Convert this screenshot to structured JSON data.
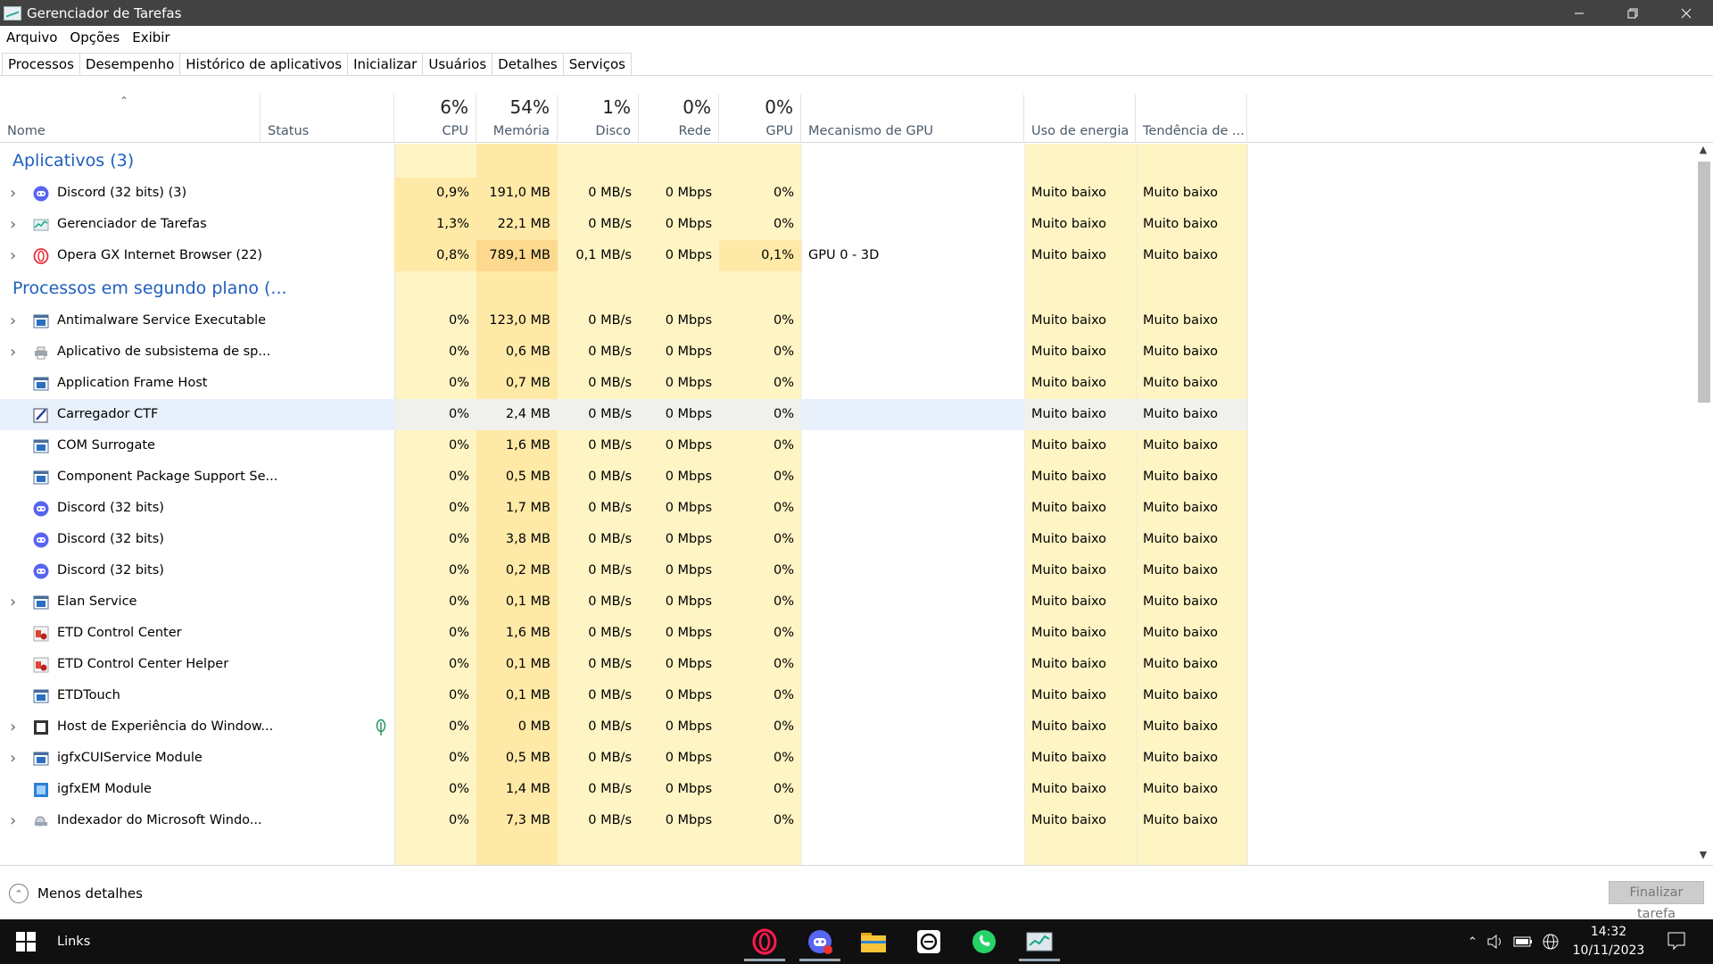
{
  "window": {
    "title": "Gerenciador de Tarefas",
    "minimize_icon": "minimize-icon",
    "restore_icon": "restore-icon",
    "close_icon": "close-icon"
  },
  "menu": [
    "Arquivo",
    "Opções",
    "Exibir"
  ],
  "tabs": [
    "Processos",
    "Desempenho",
    "Histórico de aplicativos",
    "Inicializar",
    "Usuários",
    "Detalhes",
    "Serviços"
  ],
  "columns": {
    "name": "Nome",
    "status": "Status",
    "cpu": {
      "pct": "6%",
      "label": "CPU"
    },
    "memory": {
      "pct": "54%",
      "label": "Memória"
    },
    "disk": {
      "pct": "1%",
      "label": "Disco"
    },
    "network": {
      "pct": "0%",
      "label": "Rede"
    },
    "gpu": {
      "pct": "0%",
      "label": "GPU"
    },
    "gpu_engine": "Mecanismo de GPU",
    "power": "Uso de energia",
    "power_trend": "Tendência de ..."
  },
  "groups": [
    {
      "title": "Aplicativos (3)",
      "rows": [
        {
          "name": "Discord (32 bits) (3)",
          "icon": "discord",
          "expand": true,
          "cpu": "0,9%",
          "mem": "191,0 MB",
          "disk": "0 MB/s",
          "net": "0 Mbps",
          "gpu": "0%",
          "engine": "",
          "power": "Muito baixo",
          "trend": "Muito baixo"
        },
        {
          "name": "Gerenciador de Tarefas",
          "icon": "taskmgr",
          "expand": true,
          "cpu": "1,3%",
          "mem": "22,1 MB",
          "disk": "0 MB/s",
          "net": "0 Mbps",
          "gpu": "0%",
          "engine": "",
          "power": "Muito baixo",
          "trend": "Muito baixo"
        },
        {
          "name": "Opera GX Internet Browser (22)",
          "icon": "opera",
          "expand": true,
          "cpu": "0,8%",
          "mem": "789,1 MB",
          "disk": "0,1 MB/s",
          "net": "0 Mbps",
          "gpu": "0,1%",
          "engine": "GPU 0 - 3D",
          "power": "Muito baixo",
          "trend": "Muito baixo"
        }
      ]
    },
    {
      "title": "Processos em segundo plano (...",
      "rows": [
        {
          "name": "Antimalware Service Executable",
          "icon": "window",
          "expand": true,
          "cpu": "0%",
          "mem": "123,0 MB",
          "disk": "0 MB/s",
          "net": "0 Mbps",
          "gpu": "0%",
          "engine": "",
          "power": "Muito baixo",
          "trend": "Muito baixo"
        },
        {
          "name": "Aplicativo de subsistema de sp...",
          "icon": "printer",
          "expand": true,
          "cpu": "0%",
          "mem": "0,6 MB",
          "disk": "0 MB/s",
          "net": "0 Mbps",
          "gpu": "0%",
          "engine": "",
          "power": "Muito baixo",
          "trend": "Muito baixo"
        },
        {
          "name": "Application Frame Host",
          "icon": "window",
          "expand": false,
          "cpu": "0%",
          "mem": "0,7 MB",
          "disk": "0 MB/s",
          "net": "0 Mbps",
          "gpu": "0%",
          "engine": "",
          "power": "Muito baixo",
          "trend": "Muito baixo"
        },
        {
          "name": "Carregador CTF",
          "icon": "ctf",
          "expand": false,
          "cpu": "0%",
          "mem": "2,4 MB",
          "disk": "0 MB/s",
          "net": "0 Mbps",
          "gpu": "0%",
          "engine": "",
          "power": "Muito baixo",
          "trend": "Muito baixo",
          "highlight": true
        },
        {
          "name": "COM Surrogate",
          "icon": "window",
          "expand": false,
          "cpu": "0%",
          "mem": "1,6 MB",
          "disk": "0 MB/s",
          "net": "0 Mbps",
          "gpu": "0%",
          "engine": "",
          "power": "Muito baixo",
          "trend": "Muito baixo"
        },
        {
          "name": "Component Package Support Se...",
          "icon": "window",
          "expand": false,
          "cpu": "0%",
          "mem": "0,5 MB",
          "disk": "0 MB/s",
          "net": "0 Mbps",
          "gpu": "0%",
          "engine": "",
          "power": "Muito baixo",
          "trend": "Muito baixo"
        },
        {
          "name": "Discord (32 bits)",
          "icon": "discord",
          "expand": false,
          "cpu": "0%",
          "mem": "1,7 MB",
          "disk": "0 MB/s",
          "net": "0 Mbps",
          "gpu": "0%",
          "engine": "",
          "power": "Muito baixo",
          "trend": "Muito baixo"
        },
        {
          "name": "Discord (32 bits)",
          "icon": "discord",
          "expand": false,
          "cpu": "0%",
          "mem": "3,8 MB",
          "disk": "0 MB/s",
          "net": "0 Mbps",
          "gpu": "0%",
          "engine": "",
          "power": "Muito baixo",
          "trend": "Muito baixo"
        },
        {
          "name": "Discord (32 bits)",
          "icon": "discord",
          "expand": false,
          "cpu": "0%",
          "mem": "0,2 MB",
          "disk": "0 MB/s",
          "net": "0 Mbps",
          "gpu": "0%",
          "engine": "",
          "power": "Muito baixo",
          "trend": "Muito baixo"
        },
        {
          "name": "Elan Service",
          "icon": "window",
          "expand": true,
          "cpu": "0%",
          "mem": "0,1 MB",
          "disk": "0 MB/s",
          "net": "0 Mbps",
          "gpu": "0%",
          "engine": "",
          "power": "Muito baixo",
          "trend": "Muito baixo"
        },
        {
          "name": "ETD Control Center",
          "icon": "etd",
          "expand": false,
          "cpu": "0%",
          "mem": "1,6 MB",
          "disk": "0 MB/s",
          "net": "0 Mbps",
          "gpu": "0%",
          "engine": "",
          "power": "Muito baixo",
          "trend": "Muito baixo"
        },
        {
          "name": "ETD Control Center Helper",
          "icon": "etd",
          "expand": false,
          "cpu": "0%",
          "mem": "0,1 MB",
          "disk": "0 MB/s",
          "net": "0 Mbps",
          "gpu": "0%",
          "engine": "",
          "power": "Muito baixo",
          "trend": "Muito baixo"
        },
        {
          "name": "ETDTouch",
          "icon": "window",
          "expand": false,
          "cpu": "0%",
          "mem": "0,1 MB",
          "disk": "0 MB/s",
          "net": "0 Mbps",
          "gpu": "0%",
          "engine": "",
          "power": "Muito baixo",
          "trend": "Muito baixo"
        },
        {
          "name": "Host de Experiência do Window...",
          "icon": "host",
          "expand": true,
          "cpu": "0%",
          "mem": "0 MB",
          "disk": "0 MB/s",
          "net": "0 Mbps",
          "gpu": "0%",
          "engine": "",
          "power": "Muito baixo",
          "trend": "Muito baixo",
          "status_icon": "leaf"
        },
        {
          "name": "igfxCUIService Module",
          "icon": "window",
          "expand": true,
          "cpu": "0%",
          "mem": "0,5 MB",
          "disk": "0 MB/s",
          "net": "0 Mbps",
          "gpu": "0%",
          "engine": "",
          "power": "Muito baixo",
          "trend": "Muito baixo"
        },
        {
          "name": "igfxEM Module",
          "icon": "igfx",
          "expand": false,
          "cpu": "0%",
          "mem": "1,4 MB",
          "disk": "0 MB/s",
          "net": "0 Mbps",
          "gpu": "0%",
          "engine": "",
          "power": "Muito baixo",
          "trend": "Muito baixo"
        },
        {
          "name": "Indexador do Microsoft Windo...",
          "icon": "indexer",
          "expand": true,
          "cpu": "0%",
          "mem": "7,3 MB",
          "disk": "0 MB/s",
          "net": "0 Mbps",
          "gpu": "0%",
          "engine": "",
          "power": "Muito baixo",
          "trend": "Muito baixo"
        }
      ]
    }
  ],
  "footer": {
    "less_details": "Menos detalhes",
    "end_task": "Finalizar tarefa"
  },
  "taskbar": {
    "links": "Links",
    "apps": [
      "opera-gx-icon",
      "discord-icon",
      "file-explorer-icon",
      "chatgpt-icon",
      "whatsapp-icon",
      "task-manager-icon"
    ],
    "time": "14:32",
    "date": "10/11/2023"
  },
  "colors": {
    "heat_light": "#fff4c4",
    "heat_med": "#ffe9a7",
    "heat_strong": "#fcd98e",
    "group_title": "#1f5fbf",
    "titlebar": "#424242",
    "taskbar": "#101010"
  }
}
